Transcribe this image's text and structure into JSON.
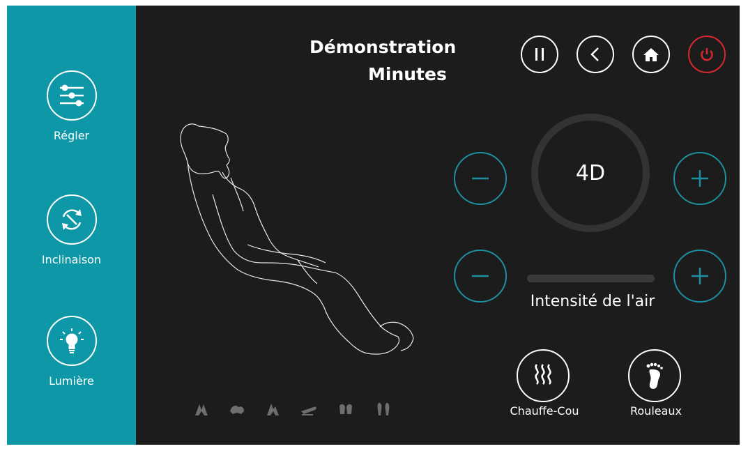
{
  "sidebar": {
    "items": [
      {
        "label": "Régler",
        "icon": "sliders-icon"
      },
      {
        "label": "Inclinaison",
        "icon": "recline-arrows-icon"
      },
      {
        "label": "Lumière",
        "icon": "lightbulb-icon"
      }
    ]
  },
  "header": {
    "title_line1": "Démonstration",
    "title_line2": "Minutes",
    "buttons": [
      "pause-icon",
      "back-icon",
      "home-icon",
      "power-icon"
    ]
  },
  "dial": {
    "label": "4D"
  },
  "air": {
    "label": "Intensité de l'air",
    "level": 0.0
  },
  "features": [
    {
      "label": "Chauffe-Cou",
      "icon": "heat-waves-icon"
    },
    {
      "label": "Rouleaux",
      "icon": "foot-icon"
    }
  ],
  "massage_modes": [
    "mode-shoulder-icon",
    "mode-back-icon",
    "mode-waist-icon",
    "mode-seat-icon",
    "mode-calf-icon",
    "mode-feet-icon"
  ],
  "colors": {
    "sidebar": "#0e97a6",
    "background": "#1c1c1c",
    "accent": "#1e8fa1",
    "power": "#d8282e"
  }
}
